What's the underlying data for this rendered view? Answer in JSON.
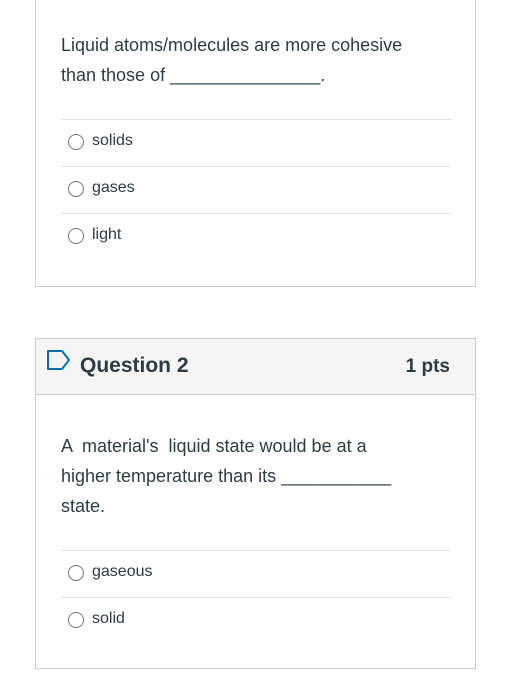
{
  "question1": {
    "text_line1": "Liquid atoms/molecules are more cohesive",
    "text_line2": "than those of _______________.",
    "answers": [
      "solids",
      "gases",
      "light"
    ]
  },
  "question2": {
    "title": "Question 2",
    "points": "1 pts",
    "text_line1": "A  material's  liquid state would be at a",
    "text_line2": "higher temperature than its ___________",
    "text_line3": "state.",
    "answers": [
      "gaseous",
      "solid"
    ]
  },
  "icons": {
    "bookmark": "bookmark-icon",
    "radio": "radio-button-icon"
  },
  "colors": {
    "text": "#2d3b45",
    "header_bg": "#f5f5f5",
    "border": "#c7cdd1",
    "bookmark": "#0770a3"
  }
}
